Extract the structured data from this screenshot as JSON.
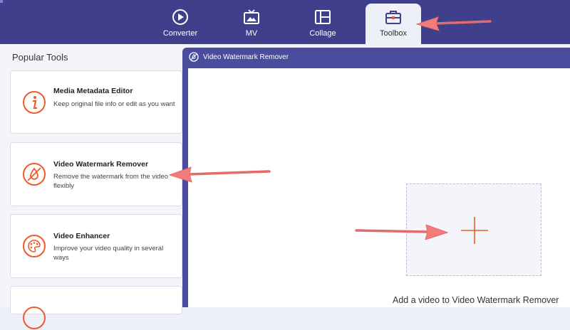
{
  "nav": {
    "tabs": [
      {
        "label": "Converter",
        "icon": "converter-icon"
      },
      {
        "label": "MV",
        "icon": "mv-icon"
      },
      {
        "label": "Collage",
        "icon": "collage-icon"
      },
      {
        "label": "Toolbox",
        "icon": "toolbox-icon",
        "active": true
      }
    ]
  },
  "left_panel": {
    "title": "Popular Tools",
    "cards": [
      {
        "title": "Media Metadata Editor",
        "desc": "Keep original file info or edit as you want",
        "icon": "info-icon"
      },
      {
        "title": "Video Watermark Remover",
        "desc": "Remove the watermark from the video flexibly",
        "icon": "watermark-icon"
      },
      {
        "title": "Video Enhancer",
        "desc": "Improve your video quality in several ways",
        "icon": "palette-icon"
      }
    ]
  },
  "window": {
    "title": "Video Watermark Remover",
    "add_text": "Add a video to Video Watermark Remover"
  },
  "colors": {
    "nav_bg": "#3f3f8b",
    "accent_orange": "#f05a28",
    "arrow": "#f47b7b"
  }
}
